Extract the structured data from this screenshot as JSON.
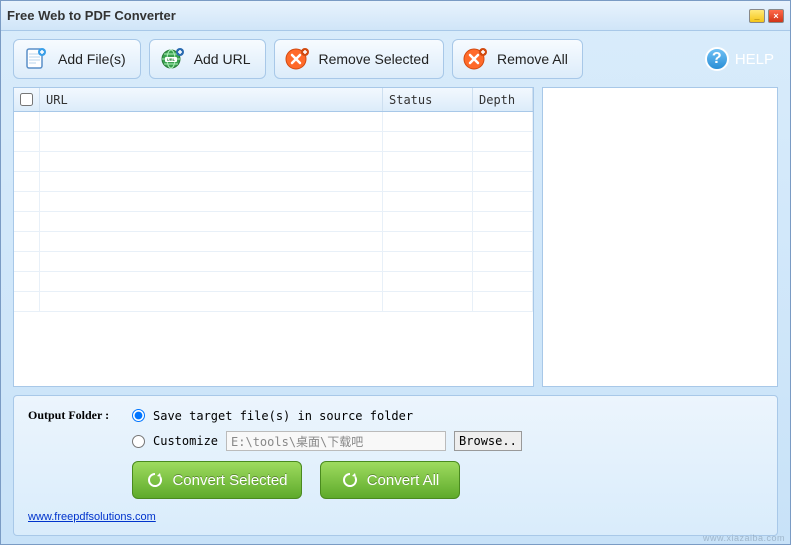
{
  "window": {
    "title": "Free Web to PDF Converter"
  },
  "toolbar": {
    "add_files": "Add File(s)",
    "add_url": "Add URL",
    "remove_selected": "Remove Selected",
    "remove_all": "Remove All",
    "help": "HELP"
  },
  "table": {
    "headers": {
      "url": "URL",
      "status": "Status",
      "depth": "Depth"
    },
    "rows": []
  },
  "output": {
    "label": "Output Folder :",
    "opt_source": "Save target file(s) in source folder",
    "opt_custom": "Customize",
    "path": "E:\\tools\\桌面\\下载吧",
    "browse": "Browse..",
    "selected_option": "source"
  },
  "actions": {
    "convert_selected": "Convert Selected",
    "convert_all": "Convert All"
  },
  "footer": {
    "link": "www.freepdfsolutions.com"
  },
  "watermark": "www.xiazaiba.com"
}
